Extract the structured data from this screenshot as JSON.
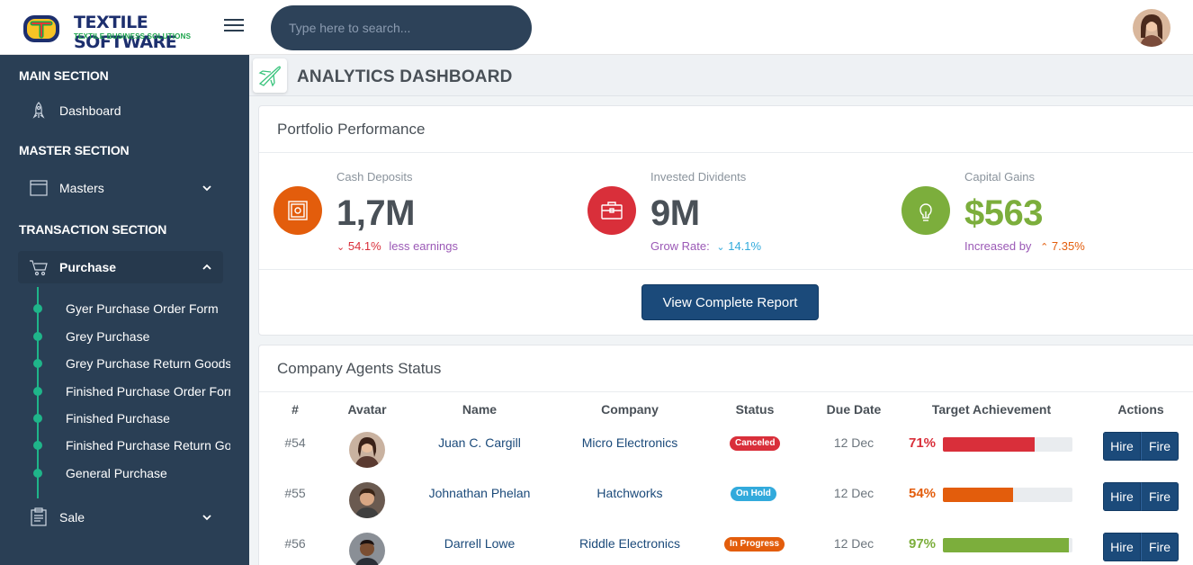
{
  "header": {
    "logo_title": "TEXTILE SOFTWARE",
    "logo_subtitle": "TEXTILE BUSINESS SOLUTIONS",
    "search_placeholder": "Type here to search..."
  },
  "sidebar": {
    "sections": [
      {
        "title": "MAIN SECTION"
      },
      {
        "title": "MASTER SECTION"
      },
      {
        "title": "TRANSACTION SECTION"
      }
    ],
    "items": [
      {
        "label": "Dashboard",
        "icon": "rocket-icon"
      },
      {
        "label": "Masters",
        "icon": "window-icon"
      },
      {
        "label": "Purchase",
        "icon": "cart-icon"
      },
      {
        "label": "Sale",
        "icon": "clipboard-icon"
      }
    ],
    "purchase_submenu": [
      "Gyer Purchase Order Form",
      "Grey Purchase",
      "Grey Purchase Return Goods",
      "Finished Purchase Order Form",
      "Finished Purchase",
      "Finished Purchase Return Goods",
      "General Purchase"
    ]
  },
  "page": {
    "title": "ANALYTICS DASHBOARD",
    "title_icon": "plane-icon"
  },
  "portfolio": {
    "title": "Portfolio Performance",
    "stats": [
      {
        "label": "Cash Deposits",
        "value": "1,7M",
        "trend_value": "54.1%",
        "trend_text": "less earnings",
        "color": "#e35d0c",
        "icon": "safe-icon"
      },
      {
        "label": "Invested Dividents",
        "value": "9M",
        "prefix": "Grow Rate:",
        "trend_value": "14.1%",
        "color": "#d92f3a",
        "icon": "briefcase-icon"
      },
      {
        "label": "Capital Gains",
        "value": "$563",
        "prefix": "Increased by",
        "trend_value": "7.35%",
        "color": "#7cae3c",
        "icon": "lightbulb-icon"
      }
    ],
    "button_label": "View Complete Report"
  },
  "agents": {
    "title": "Company Agents Status",
    "columns": [
      "#",
      "Avatar",
      "Name",
      "Company",
      "Status",
      "Due Date",
      "Target Achievement",
      "Actions"
    ],
    "rows": [
      {
        "id": "#54",
        "name": "Juan C. Cargill",
        "company": "Micro Electronics",
        "status": "Canceled",
        "status_color": "#d92f3a",
        "due": "12 Dec",
        "pct_label": "71%",
        "pct": 71,
        "bar_color": "#d92f3a",
        "pct_color": "#d92f3a"
      },
      {
        "id": "#55",
        "name": "Johnathan Phelan",
        "company": "Hatchworks",
        "status": "On Hold",
        "status_color": "#32aadc",
        "due": "12 Dec",
        "pct_label": "54%",
        "pct": 54,
        "bar_color": "#e35d0c",
        "pct_color": "#e35d0c"
      },
      {
        "id": "#56",
        "name": "Darrell Lowe",
        "company": "Riddle Electronics",
        "status": "In Progress",
        "status_color": "#e35d0c",
        "due": "12 Dec",
        "pct_label": "97%",
        "pct": 97,
        "bar_color": "#7cae3c",
        "pct_color": "#7cae3c"
      }
    ],
    "actions": [
      "Hire",
      "Fire"
    ]
  }
}
